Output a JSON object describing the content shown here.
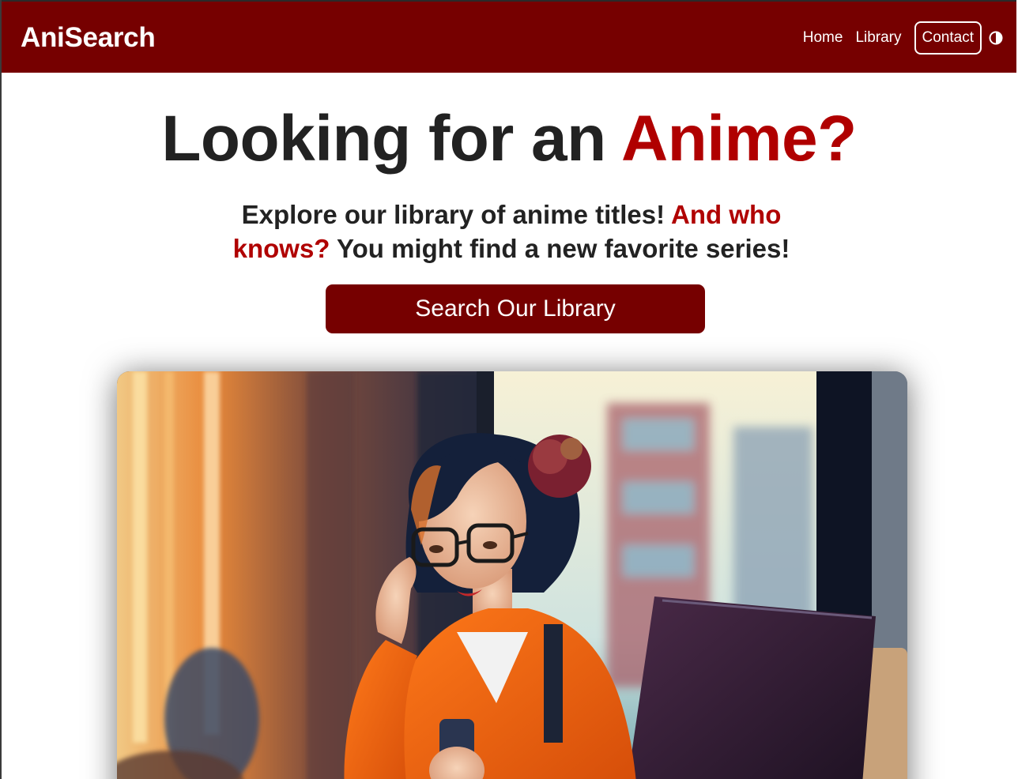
{
  "navbar": {
    "brand": "AniSearch",
    "links": [
      "Home",
      "Library",
      "Contact"
    ],
    "theme_toggle_icon": "contrast-icon",
    "background": "#760000"
  },
  "hero": {
    "title_part1": "Looking for an ",
    "title_accent": "Anime?",
    "subtitle_part1": "Explore our library of anime titles! ",
    "subtitle_accent": "And who knows?",
    "subtitle_part2": " You might find a new favorite series!",
    "cta_label": "Search Our Library",
    "accent_color": "#b00000"
  }
}
